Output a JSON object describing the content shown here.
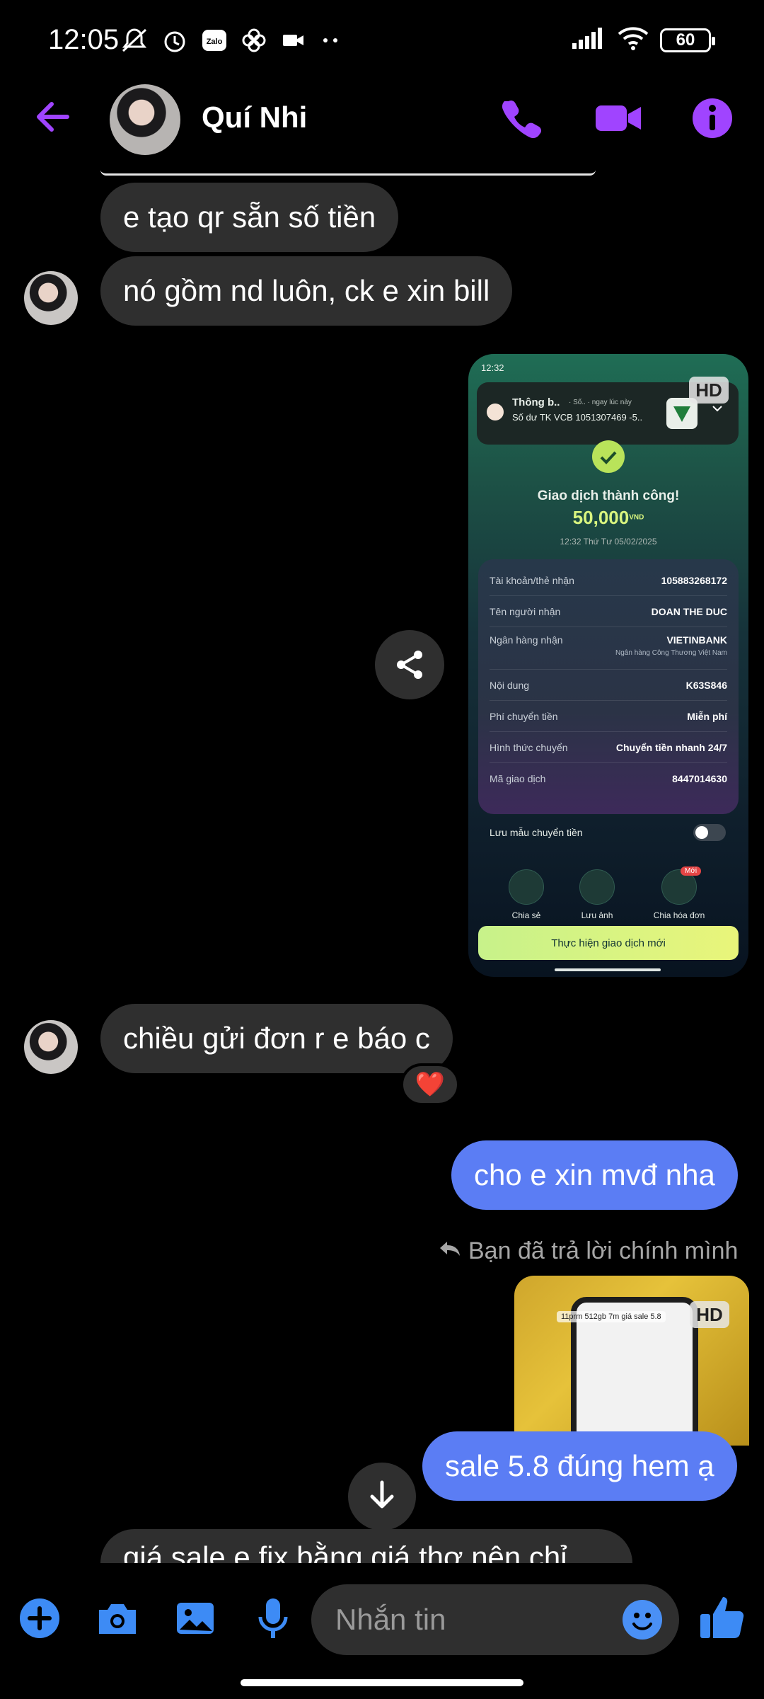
{
  "status_bar": {
    "time": "12:05",
    "battery": "60"
  },
  "header": {
    "contact_name": "Quí Nhi"
  },
  "messages": {
    "m1": "e tạo qr sẵn số tiền",
    "m2": "nó gồm nd luôn, ck e xin bill",
    "m3": "chiều gửi đơn r e báo c",
    "m3_reaction": "❤️",
    "m4": "cho e xin mvđ nha",
    "reply_note": "Bạn đã trả lời chính mình",
    "m5": "sale 5.8 đúng hem ạ",
    "m6_partial": "giá sale e fix bằng giá thợ nên chỉ"
  },
  "shared_image": {
    "hd_badge": "HD",
    "status_time": "12:32",
    "notif_title": "Thông b..",
    "notif_meta": "· Số.. · ngay lúc này",
    "notif_body": "Số dư TK VCB 1051307469 -5..",
    "success_title": "Giao dịch thành công!",
    "amount": "50,000",
    "currency": "VND",
    "datetime": "12:32 Thứ Tư 05/02/2025",
    "rows": [
      {
        "k": "Tài khoản/thẻ nhận",
        "v": "105883268172"
      },
      {
        "k": "Tên người nhận",
        "v": "DOAN THE DUC"
      },
      {
        "k": "Ngân hàng nhận",
        "v": "VIETINBANK"
      },
      {
        "k": "Nội dung",
        "v": "K63S846"
      },
      {
        "k": "Phí chuyển tiền",
        "v": "Miễn phí"
      },
      {
        "k": "Hình thức chuyển",
        "v": "Chuyển tiền nhanh 24/7"
      },
      {
        "k": "Mã giao dịch",
        "v": "8447014630"
      }
    ],
    "bank_full_name": "Ngân hàng Công Thương Việt Nam",
    "save_template": "Lưu mẫu chuyển tiền",
    "actions": [
      "Chia sẻ",
      "Lưu ảnh",
      "Chia hóa đơn"
    ],
    "new_badge": "Mới",
    "cta": "Thực hiện giao dịch mới"
  },
  "reply_thumb": {
    "hd_badge": "HD",
    "caption": "11prm 512gb 7m giá sale 5.8"
  },
  "composer": {
    "placeholder": "Nhắn tin"
  },
  "colors": {
    "accent": "#a044ff",
    "outgoing_bubble": "#5b7df4",
    "incoming_bubble": "#2f2f2f"
  }
}
